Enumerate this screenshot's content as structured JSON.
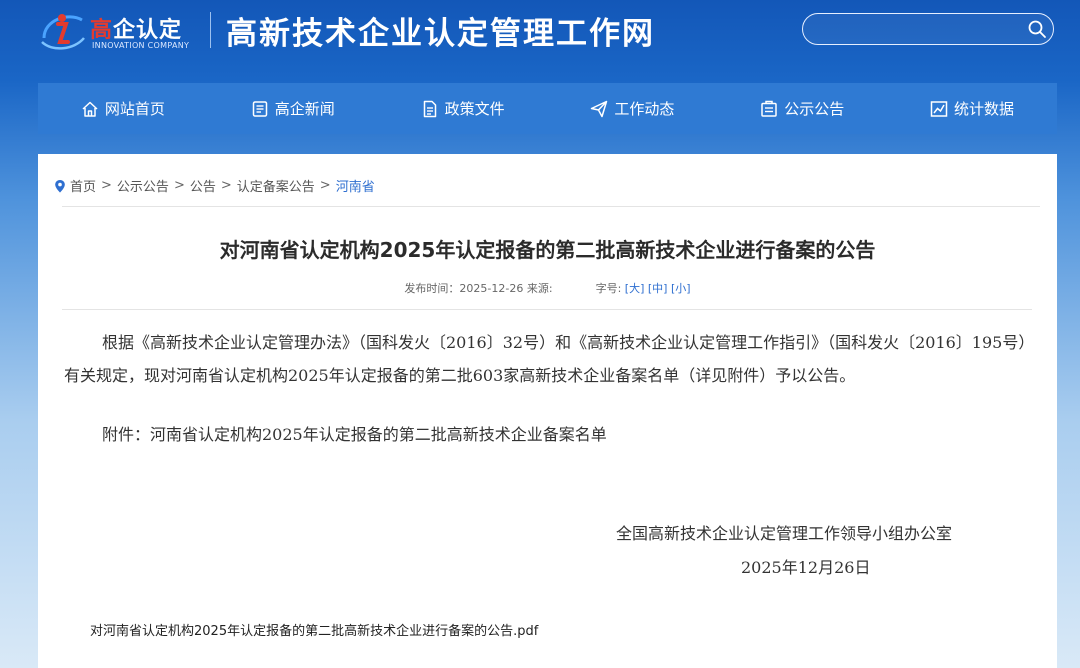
{
  "header": {
    "logo_cn_red": "高",
    "logo_cn_white": "企认定",
    "logo_en": "INNOVATION COMPANY",
    "site_title": "高新技术企业认定管理工作网",
    "search_placeholder": "",
    "search_icon": "search-icon"
  },
  "nav": {
    "items": [
      {
        "label": "网站首页",
        "icon": "home-icon"
      },
      {
        "label": "高企新闻",
        "icon": "news-icon"
      },
      {
        "label": "政策文件",
        "icon": "document-icon"
      },
      {
        "label": "工作动态",
        "icon": "paper-plane-icon"
      },
      {
        "label": "公示公告",
        "icon": "notice-icon"
      },
      {
        "label": "统计数据",
        "icon": "chart-icon"
      }
    ]
  },
  "breadcrumb": {
    "items": [
      "首页",
      "公示公告",
      "公告",
      "认定备案公告",
      "河南省"
    ],
    "separator": ">"
  },
  "article": {
    "title": "对河南省认定机构2025年认定报备的第二批高新技术企业进行备案的公告",
    "publish_label": "发布时间：",
    "publish_date": "2025-12-26",
    "source_label": "来源:",
    "font_size_label": "字号:",
    "font_large": "[大]",
    "font_medium": "[中]",
    "font_small": "[小]",
    "paragraph_1": "根据《高新技术企业认定管理办法》（国科发火〔2016〕32号）和《高新技术企业认定管理工作指引》（国科发火〔2016〕195号）有关规定，现对河南省认定机构2025年认定报备的第二批603家高新技术企业备案名单（详见附件）予以公告。",
    "paragraph_2": "附件：河南省认定机构2025年认定报备的第二批高新技术企业备案名单",
    "signature_org": "全国高新技术企业认定管理工作领导小组办公室",
    "signature_date": "2025年12月26日",
    "attachment": "对河南省认定机构2025年认定报备的第二批高新技术企业进行备案的公告.pdf"
  },
  "colors": {
    "header_blue": "#1a66c6",
    "nav_blue": "#2f7ad3",
    "link_blue": "#2f6fd0",
    "logo_red": "#e33b2e"
  }
}
